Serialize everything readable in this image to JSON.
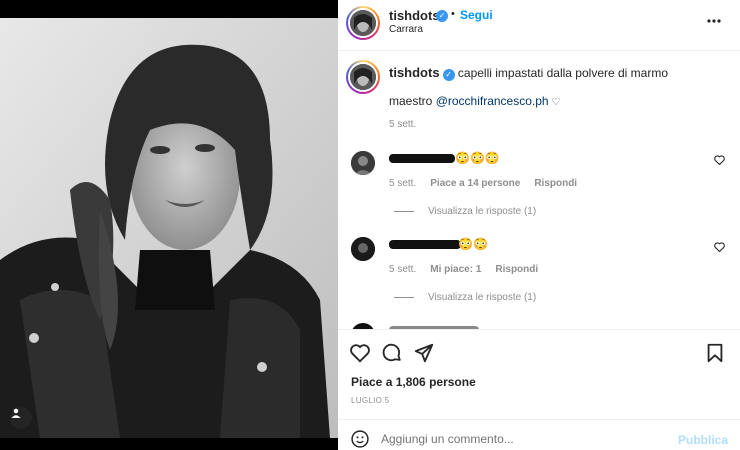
{
  "header": {
    "username": "tishdots",
    "verified_glyph": "✓",
    "separator": "•",
    "follow_label": "Segui",
    "location": "Carrara",
    "more_icon": "more-icon"
  },
  "caption": {
    "username": "tishdots",
    "text": "capelli impastati dalla polvere di marmo",
    "line2_prefix": "maestro ",
    "mention": "@rocchifrancesco.ph",
    "line2_suffix": " ♡",
    "time": "5 sett."
  },
  "comments": [
    {
      "emoji": "😳😳😳",
      "time": "5 sett.",
      "likes": "Piace a 14 persone",
      "reply_label": "Rispondi",
      "view_replies": "Visualizza le risposte (1)"
    },
    {
      "emoji": "😳😳",
      "time": "5 sett.",
      "likes": "Mi piace: 1",
      "reply_label": "Rispondi",
      "view_replies": "Visualizza le risposte (1)"
    }
  ],
  "actions": {
    "likes_count": "Piace a 1,806 persone",
    "date": "LUGLIO 5"
  },
  "composer": {
    "placeholder": "Aggiungi un commento...",
    "publish_label": "Pubblica"
  },
  "colors": {
    "accent": "#0095f6",
    "link": "#00376b",
    "muted": "#8e8e8e",
    "text": "#262626"
  }
}
